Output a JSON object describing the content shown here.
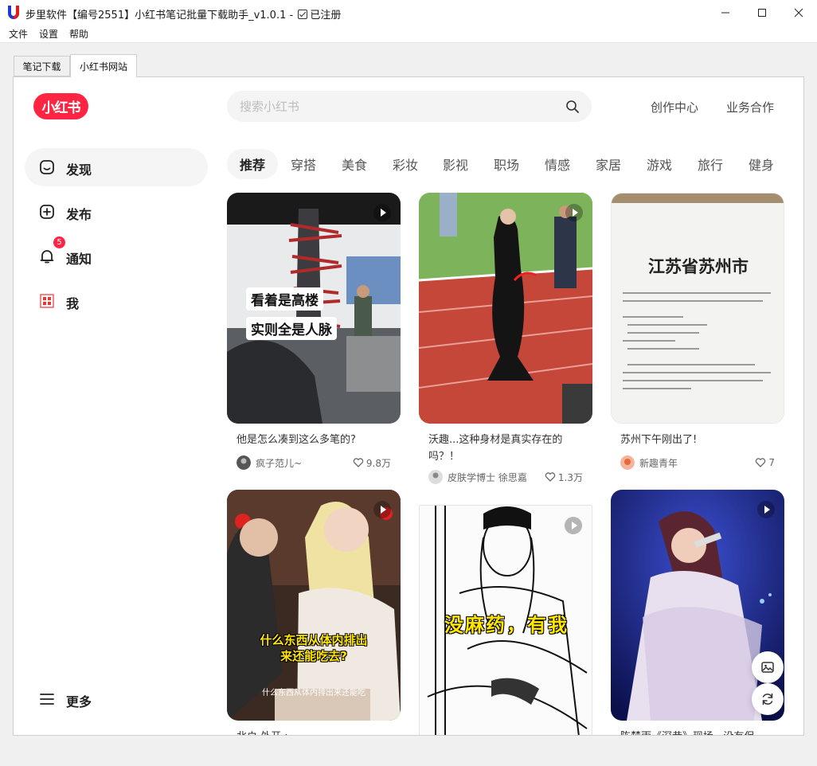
{
  "window": {
    "title_prefix": "步里软件【编号2551】小红书笔记批量下载助手_v1.0.1 -",
    "title_suffix": "已注册",
    "menu": [
      "文件",
      "设置",
      "帮助"
    ]
  },
  "tabs": [
    {
      "label": "笔记下载",
      "active": false
    },
    {
      "label": "小红书网站",
      "active": true
    }
  ],
  "site": {
    "logo": "小红书",
    "search": {
      "placeholder": "搜索小红书",
      "value": ""
    },
    "header_links": [
      "创作中心",
      "业务合作"
    ],
    "nav": [
      {
        "label": "发现",
        "icon": "discover-icon",
        "active": true
      },
      {
        "label": "发布",
        "icon": "publish-icon",
        "active": false
      },
      {
        "label": "通知",
        "icon": "bell-icon",
        "active": false,
        "badge": "5"
      },
      {
        "label": "我",
        "icon": "profile-avatar-icon",
        "active": false
      }
    ],
    "more": "更多",
    "channels": [
      "推荐",
      "穿搭",
      "美食",
      "彩妆",
      "影视",
      "职场",
      "情感",
      "家居",
      "游戏",
      "旅行",
      "健身"
    ],
    "brand_color": "#ff2442",
    "cards": [
      {
        "title": "他是怎么凑到这么多笔的?",
        "author": "疯子范儿~",
        "likes": "9.8万",
        "video": true,
        "overlay": [
          "看着是高楼",
          "实则全是人脉"
        ]
      },
      {
        "title": "沃趣...这种身材是真实存在的吗？！",
        "author": "皮肤学博士 徐思嘉",
        "likes": "1.3万",
        "video": true
      },
      {
        "title": "苏州下午刚出了!",
        "author": "新趣青年",
        "likes": "7",
        "video": false,
        "overlay_heading": "江苏省苏州市"
      },
      {
        "title": "北ウ 外开 :",
        "video": true,
        "subtitle": [
          "什么东西从体内排出",
          "来还能吃去?"
        ],
        "caption": "什么东西从体内排出来还能吃"
      },
      {
        "title": "",
        "video": true,
        "subtitle": [
          "没麻药，有我"
        ]
      },
      {
        "title": "陈楚雨《深巷》现场...没有保",
        "video": true
      }
    ]
  }
}
